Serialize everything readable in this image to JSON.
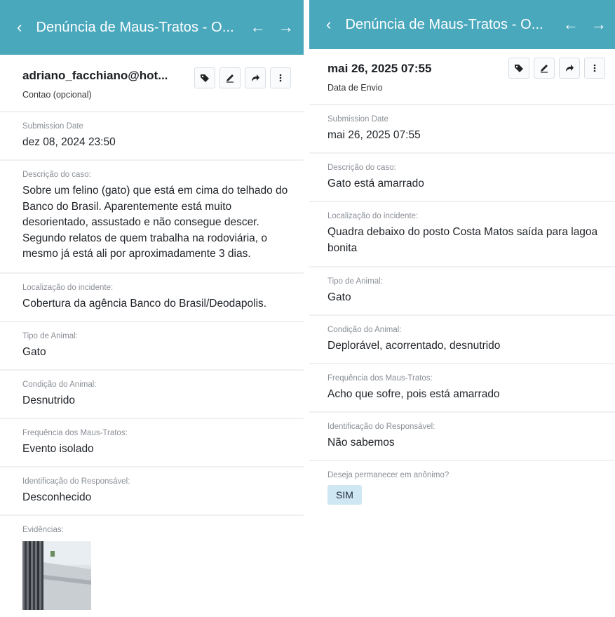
{
  "left": {
    "topbar": {
      "back_icon": "chevron-left-icon",
      "title": "Denúncia de Maus-Tratos - O...",
      "prev_icon": "arrow-left-icon",
      "next_icon": "arrow-right-icon",
      "color": "#4aa8bd"
    },
    "header": {
      "title": "adriano_facchiano@hot...",
      "subtitle": "Contao (opcional)",
      "actions": [
        "tag-icon",
        "edit-pencil-icon",
        "share-arrow-icon",
        "more-vertical-icon"
      ]
    },
    "fields": [
      {
        "label": "Submission Date",
        "value": "dez 08, 2024 23:50"
      },
      {
        "label": "Descrição do caso:",
        "value": "Sobre um felino (gato) que está em cima do telhado do Banco do Brasil. Aparentemente está muito desorientado, assustado e não consegue descer. Segundo relatos de quem trabalha na rodoviária, o mesmo já está ali por aproximadamente 3 dias."
      },
      {
        "label": "Localização do incidente:",
        "value": "Cobertura da agência Banco do Brasil/Deodapolis."
      },
      {
        "label": "Tipo de Animal:",
        "value": "Gato"
      },
      {
        "label": "Condição do Animal:",
        "value": "Desnutrido"
      },
      {
        "label": "Frequência dos Maus-Tratos:",
        "value": "Evento isolado"
      },
      {
        "label": "Identificação do Responsável:",
        "value": "Desconhecido"
      }
    ],
    "evidence": {
      "label": "Evidências:"
    }
  },
  "right": {
    "topbar": {
      "back_icon": "chevron-left-icon",
      "title": "Denúncia de Maus-Tratos - O...",
      "prev_icon": "arrow-left-icon",
      "next_icon": "arrow-right-icon",
      "color": "#4aa8bd"
    },
    "header": {
      "title": "mai 26, 2025 07:55",
      "subtitle": "Data de Envio",
      "actions": [
        "tag-icon",
        "edit-pencil-icon",
        "share-arrow-icon",
        "more-vertical-icon"
      ]
    },
    "fields": [
      {
        "label": "Submission Date",
        "value": "mai 26, 2025 07:55"
      },
      {
        "label": "Descrição do caso:",
        "value": "Gato está amarrado"
      },
      {
        "label": "Localização do incidente:",
        "value": "Quadra debaixo do posto Costa Matos saída para lagoa bonita"
      },
      {
        "label": "Tipo de Animal:",
        "value": "Gato"
      },
      {
        "label": "Condição do Animal:",
        "value": "Deplorável, acorrentado, desnutrido"
      },
      {
        "label": "Frequência dos Maus-Tratos:",
        "value": "Acho que sofre, pois está amarrado"
      },
      {
        "label": "Identificação do Responsável:",
        "value": "Não sabemos"
      }
    ],
    "anonymous": {
      "label": "Deseja permanecer em anônimo?",
      "value": "SIM",
      "chip_color": "#cfe6f3"
    }
  }
}
